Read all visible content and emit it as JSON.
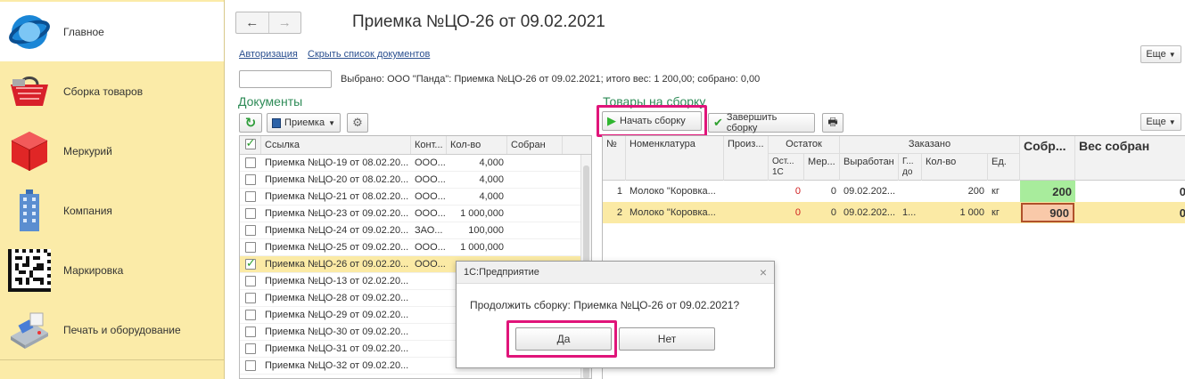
{
  "sidebar": {
    "items": [
      {
        "label": "Главное",
        "icon": "globe-icon"
      },
      {
        "label": "Сборка товаров",
        "icon": "basket-icon"
      },
      {
        "label": "Меркурий",
        "icon": "cube-icon"
      },
      {
        "label": "Компания",
        "icon": "building-icon"
      },
      {
        "label": "Маркировка",
        "icon": "datamatrix-icon"
      },
      {
        "label": "Печать и оборудование",
        "icon": "pos-terminal-icon"
      }
    ]
  },
  "header": {
    "back": "←",
    "forward": "→",
    "title": "Приемка №ЦО-26 от 09.02.2021"
  },
  "links": {
    "auth": "Авторизация",
    "hide_docs": "Скрыть список документов"
  },
  "more_label": "Еще",
  "info_line": "Выбрано: ООО \"Панда\": Приемка №ЦО-26 от 09.02.2021; итого вес: 1 200,00; собрано: 0,00",
  "documents": {
    "title": "Документы",
    "type_button": "Приемка",
    "columns": [
      "Ссылка",
      "Конт...",
      "Кол-во",
      "Собран"
    ],
    "rows": [
      {
        "link": "Приемка №ЦО-19 от 08.02.20...",
        "k": "ООО...",
        "q": "4,000",
        "checked": false
      },
      {
        "link": "Приемка №ЦО-20 от 08.02.20...",
        "k": "ООО...",
        "q": "4,000",
        "checked": false
      },
      {
        "link": "Приемка №ЦО-21 от 08.02.20...",
        "k": "ООО...",
        "q": "4,000",
        "checked": false
      },
      {
        "link": "Приемка №ЦО-23 от 09.02.20...",
        "k": "ООО...",
        "q": "1 000,000",
        "checked": false
      },
      {
        "link": "Приемка №ЦО-24 от 09.02.20...",
        "k": "ЗАО...",
        "q": "100,000",
        "checked": false
      },
      {
        "link": "Приемка №ЦО-25 от 09.02.20...",
        "k": "ООО...",
        "q": "1 000,000",
        "checked": false
      },
      {
        "link": "Приемка №ЦО-26 от 09.02.20...",
        "k": "ООО...",
        "q": "",
        "checked": true
      },
      {
        "link": "Приемка №ЦО-13 от 02.02.20...",
        "k": "",
        "q": "",
        "checked": false
      },
      {
        "link": "Приемка №ЦО-28 от 09.02.20...",
        "k": "",
        "q": "",
        "checked": false
      },
      {
        "link": "Приемка №ЦО-29 от 09.02.20...",
        "k": "",
        "q": "",
        "checked": false
      },
      {
        "link": "Приемка №ЦО-30 от 09.02.20...",
        "k": "",
        "q": "",
        "checked": false
      },
      {
        "link": "Приемка №ЦО-31 от 09.02.20...",
        "k": "",
        "q": "",
        "checked": false
      },
      {
        "link": "Приемка №ЦО-32 от 09.02.20...",
        "k": "",
        "q": "",
        "checked": false
      }
    ]
  },
  "goods": {
    "title": "Товары на сборку",
    "start_button": "Начать сборку",
    "finish_button": "Завершить сборку",
    "headers": {
      "n": "№",
      "nom": "Номенклатура",
      "proiz": "Произ...",
      "ostatok": "Остаток",
      "ost1c": "Ост... 1С",
      "mer": "Мер...",
      "zakazano": "Заказано",
      "vyrabotan": "Выработан",
      "gdo": "Г... до",
      "kolvo": "Кол-во",
      "ed": "Ед.",
      "sobr": "Собр...",
      "ves": "Вес собран"
    },
    "rows": [
      {
        "n": "1",
        "nom": "Молоко \"Коровка...",
        "ost": "0",
        "mer": "0",
        "vyr": "09.02.202...",
        "g": "",
        "qty": "200",
        "ed": "кг",
        "sobr": "200",
        "ves": "0"
      },
      {
        "n": "2",
        "nom": "Молоко \"Коровка...",
        "ost": "0",
        "mer": "0",
        "vyr": "09.02.202...",
        "g": "1...",
        "qty": "1 000",
        "ed": "кг",
        "sobr": "900",
        "ves": "0"
      }
    ]
  },
  "dialog": {
    "title": "1С:Предприятие",
    "message": "Продолжить сборку: Приемка №ЦО-26 от 09.02.2021?",
    "yes": "Да",
    "no": "Нет",
    "close": "×"
  }
}
